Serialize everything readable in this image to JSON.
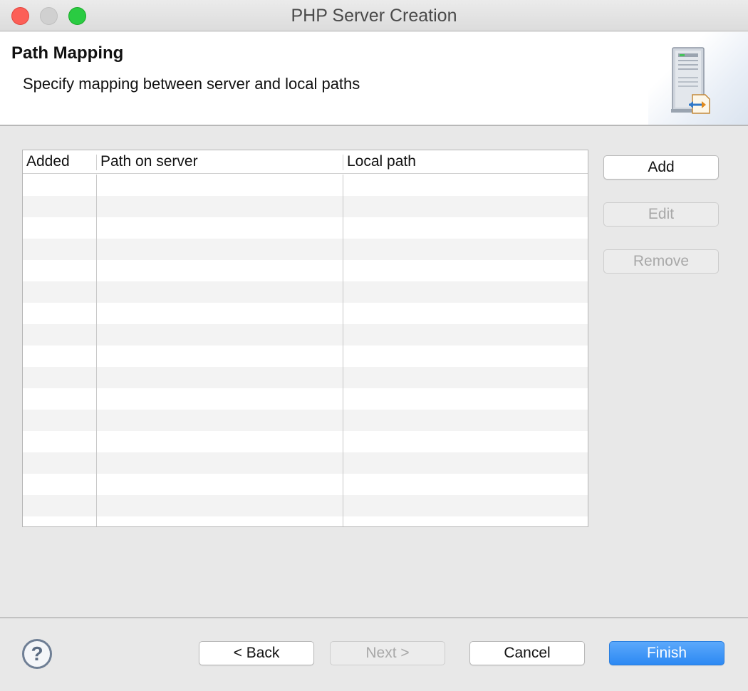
{
  "window": {
    "title": "PHP Server Creation"
  },
  "banner": {
    "title": "Path Mapping",
    "description": "Specify mapping between server and local paths"
  },
  "table": {
    "columns": [
      "Added",
      "Path on server",
      "Local path"
    ],
    "rows": []
  },
  "side_buttons": {
    "add": "Add",
    "edit": "Edit",
    "remove": "Remove"
  },
  "footer": {
    "help": "?",
    "back": "< Back",
    "next": "Next >",
    "cancel": "Cancel",
    "finish": "Finish"
  },
  "colors": {
    "primary": "#2c89f3",
    "close": "#fc5f57",
    "zoom": "#2acb42"
  }
}
